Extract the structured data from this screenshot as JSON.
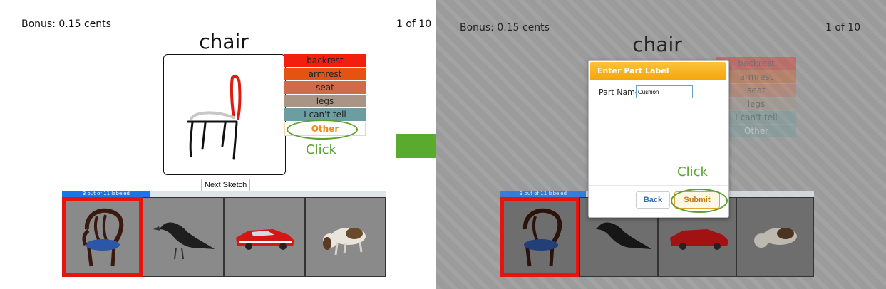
{
  "left": {
    "bonus": "Bonus: 0.15 cents",
    "counter": "1 of 10",
    "object_name": "chair",
    "labels": [
      {
        "text": "backrest",
        "color": "#f21f0f"
      },
      {
        "text": "armrest",
        "color": "#e45410"
      },
      {
        "text": "seat",
        "color": "#cf6a4a"
      },
      {
        "text": "legs",
        "color": "#a99585"
      },
      {
        "text": "I can't tell",
        "color": "#6c9da0"
      },
      {
        "text": "Other",
        "color": "#ffffff",
        "text_color": "#f08a12"
      }
    ],
    "click_hint": "Click",
    "next_button": "Next Sketch",
    "progress": {
      "text": "3 out of 11 labeled",
      "fraction": 0.2727
    }
  },
  "right": {
    "bonus": "Bonus: 0.15 cents",
    "counter": "1 of 10",
    "object_name": "chair",
    "progress": {
      "text": "3 out of 11 labeled",
      "fraction": 0.2727
    },
    "modal": {
      "title": "Enter Part Label",
      "field_label": "Part Name",
      "field_value": "Cushion",
      "click_hint": "Click",
      "back_label": "Back",
      "submit_label": "Submit"
    },
    "faded_labels": [
      "backrest",
      "armrest",
      "seat",
      "legs",
      "I can't tell",
      "Other"
    ]
  },
  "colors": {
    "accent_green": "#5aa02c",
    "arrow_green": "#5aaa2e",
    "progress_blue": "#1e74e6",
    "selected_red": "#e8140c"
  },
  "icons": [
    "chair-image",
    "crow-image",
    "car-image",
    "dog-image",
    "arrow-right-icon"
  ]
}
